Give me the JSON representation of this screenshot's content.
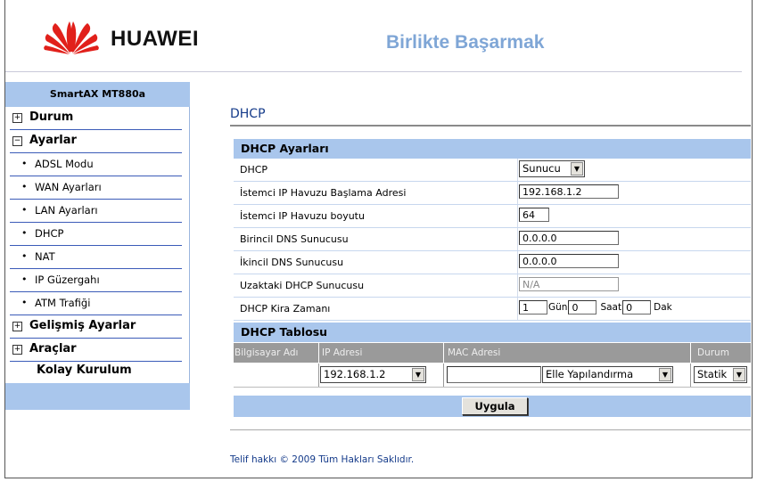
{
  "header": {
    "brand": "HUAWEI",
    "slogan": "Birlikte Başarmak"
  },
  "sidebar": {
    "title": "SmartAX MT880a",
    "items": [
      {
        "label": "Durum",
        "expander": "+"
      },
      {
        "label": "Ayarlar",
        "expander": "−"
      },
      {
        "label": "ADSL Modu"
      },
      {
        "label": "WAN Ayarları"
      },
      {
        "label": "LAN Ayarları"
      },
      {
        "label": "DHCP"
      },
      {
        "label": "NAT"
      },
      {
        "label": "IP Güzergahı"
      },
      {
        "label": "ATM Trafiği"
      },
      {
        "label": "Gelişmiş Ayarlar",
        "expander": "+"
      },
      {
        "label": "Araçlar",
        "expander": "+"
      },
      {
        "label": "Kolay Kurulum"
      }
    ]
  },
  "main": {
    "page_title": "DHCP",
    "settings": {
      "header": "DHCP Ayarları",
      "rows": [
        {
          "label": "DHCP",
          "value": "Sunucu"
        },
        {
          "label": "İstemci IP Havuzu Başlama Adresi",
          "value": "192.168.1.2"
        },
        {
          "label": "İstemci IP Havuzu boyutu",
          "value": "64"
        },
        {
          "label": "Birincil DNS Sunucusu",
          "value": "0.0.0.0"
        },
        {
          "label": "İkincil DNS Sunucusu",
          "value": "0.0.0.0"
        },
        {
          "label": "Uzaktaki DHCP Sunucusu",
          "value": "N/A"
        },
        {
          "label": "DHCP Kira Zamanı",
          "days": "1",
          "days_unit": "Gün",
          "hours": "0",
          "hours_unit": "Saat",
          "minutes": "0",
          "minutes_unit": "Dak"
        }
      ]
    },
    "table": {
      "header": "DHCP Tablosu",
      "columns": [
        "Bilgisayar Adı",
        "IP Adresi",
        "MAC Adresi",
        "Durum"
      ],
      "row": {
        "computer_name": "",
        "ip": "192.168.1.2",
        "mac": "",
        "mac_mode": "Elle Yapılandırma",
        "status": "Statik"
      }
    },
    "apply_label": "Uygula",
    "copyright": "Telif hakkı © 2009 Tüm Hakları Saklıdır."
  },
  "colors": {
    "accent": "#a9c6ec",
    "title_blue": "#153b8a",
    "slogan": "#7fa6d6",
    "logo_red": "#e1201b"
  }
}
